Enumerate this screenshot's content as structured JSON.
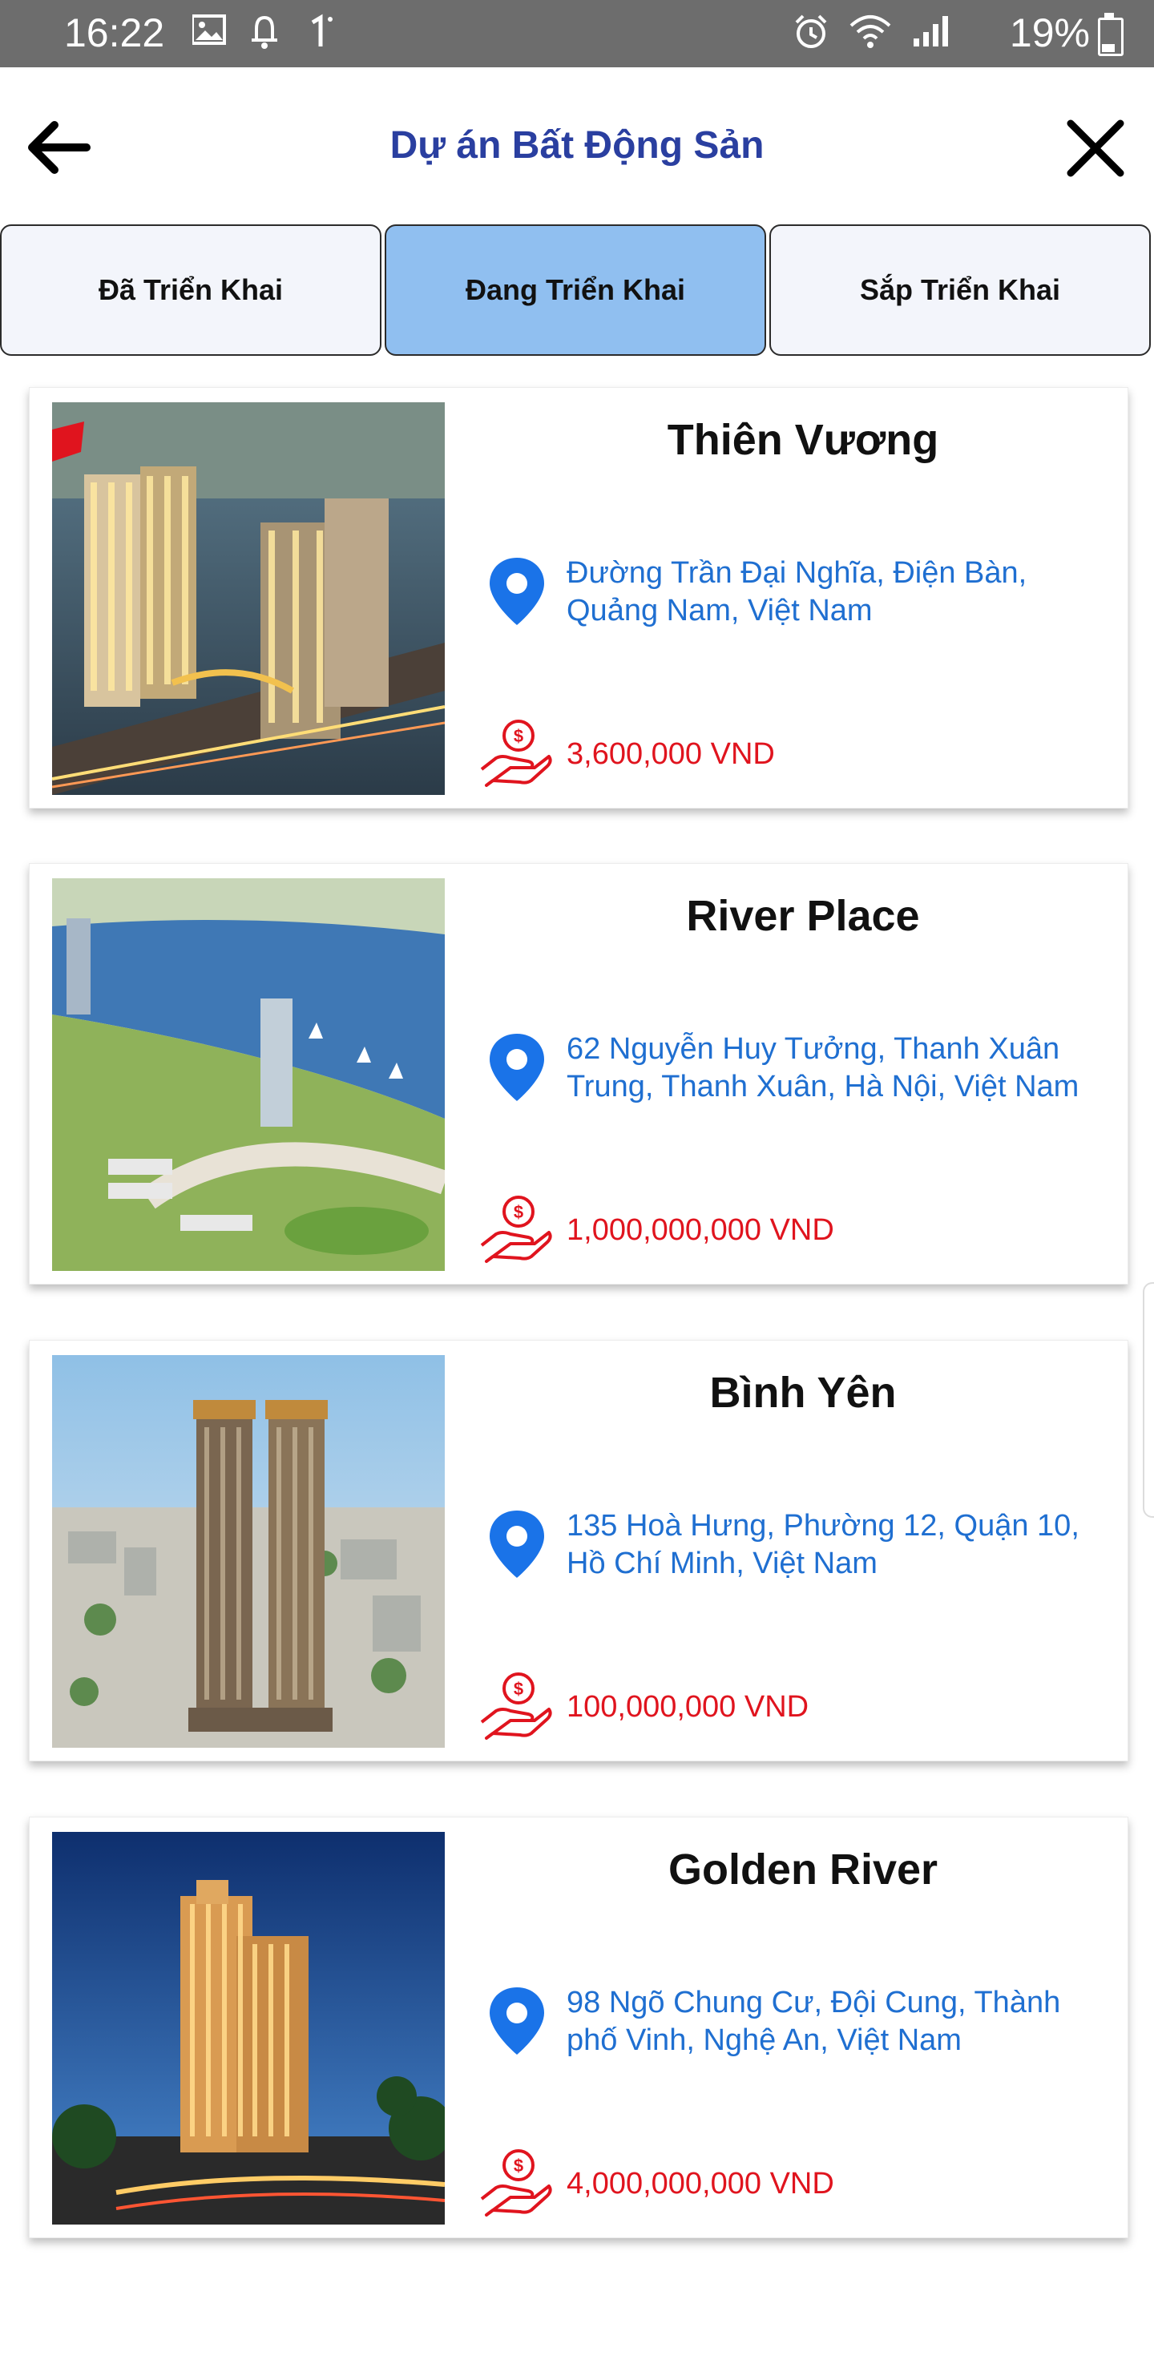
{
  "status_bar": {
    "time": "16:22",
    "battery": "19%",
    "left_icons": [
      "image-icon",
      "bell-icon",
      "one-icon"
    ],
    "right_icons": [
      "alarm-icon",
      "wifi-icon",
      "signal-icon",
      "battery-icon"
    ]
  },
  "header": {
    "title": "Dự án Bất Động Sản",
    "back_icon": "arrow-left-icon",
    "close_icon": "close-icon"
  },
  "tabs": [
    {
      "label": "Đã Triển Khai",
      "active": false
    },
    {
      "label": "Đang Triển Khai",
      "active": true
    },
    {
      "label": "Sắp Triển Khai",
      "active": false
    }
  ],
  "projects": [
    {
      "name": "Thiên Vương",
      "address": "Đường Trần Đại Nghĩa, Điện Bàn, Quảng Nam, Việt Nam",
      "price": "3,600,000 VND",
      "image": "building-photo"
    },
    {
      "name": "River Place",
      "address": "62 Nguyễn Huy Tưởng, Thanh Xuân Trung, Thanh Xuân, Hà Nội, Việt Nam",
      "price": "1,000,000,000 VND",
      "image": "river-aerial-photo"
    },
    {
      "name": "Bình Yên",
      "address": "135 Hoà Hưng, Phường 12, Quận 10, Hồ Chí Minh, Việt Nam",
      "price": "100,000,000 VND",
      "image": "twin-tower-photo"
    },
    {
      "name": "Golden River",
      "address": "98 Ngõ Chung Cư, Đội Cung, Thành phố Vinh, Nghệ An, Việt Nam",
      "price": "4,000,000,000 VND",
      "image": "night-tower-photo"
    }
  ],
  "colors": {
    "title": "#2a3fa0",
    "active_tab": "#90bff0",
    "address": "#1f6fd1",
    "price": "#e0141e",
    "pin": "#1a73e8",
    "money_icon": "#e0141e"
  }
}
